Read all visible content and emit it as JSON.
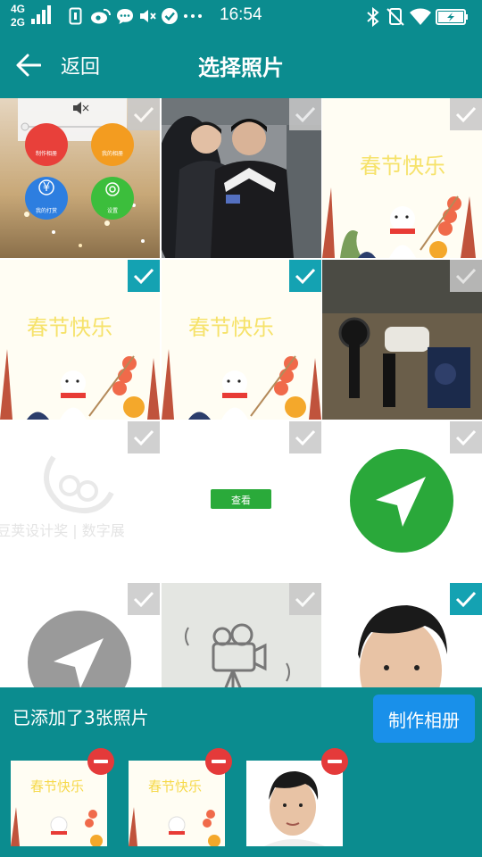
{
  "status_bar": {
    "net_top": "4G",
    "net_bottom": "2G",
    "time": "16:54",
    "icons": [
      "signal-icon",
      "sim-icon",
      "weibo-icon",
      "message-icon",
      "mute-icon",
      "check-icon",
      "more-icon",
      "bluetooth-icon",
      "no-sim-icon",
      "wifi-icon",
      "battery-icon"
    ]
  },
  "header": {
    "back_label": "返回",
    "title": "选择照片"
  },
  "grid": {
    "photos": [
      {
        "name": "screenshot-menu",
        "selected": false,
        "labels": [
          "制作相册",
          "我的相册",
          "我的打赏",
          "设置"
        ]
      },
      {
        "name": "photo-people",
        "selected": false
      },
      {
        "name": "spring-festival-card",
        "selected": false,
        "text": "春节快乐"
      },
      {
        "name": "spring-festival-card",
        "selected": true,
        "text": "春节快乐"
      },
      {
        "name": "spring-festival-card",
        "selected": true,
        "text": "春节快乐"
      },
      {
        "name": "photo-devices",
        "selected": false
      },
      {
        "name": "logo-watermark",
        "selected": false,
        "text": "豆荚设计奖 | 数字展"
      },
      {
        "name": "view-button-image",
        "selected": false,
        "text": "查看"
      },
      {
        "name": "green-send-icon",
        "selected": false
      },
      {
        "name": "grey-send-icon",
        "selected": false
      },
      {
        "name": "camera-sketch",
        "selected": false
      },
      {
        "name": "portrait-man",
        "selected": true
      }
    ]
  },
  "bottom": {
    "added_text": "已添加了3张照片",
    "make_album_label": "制作相册",
    "thumbs": [
      {
        "name": "spring-festival-card",
        "text": "春节快乐"
      },
      {
        "name": "spring-festival-card",
        "text": "春节快乐"
      },
      {
        "name": "portrait-man"
      }
    ]
  },
  "colors": {
    "primary": "#0b8c8f",
    "selected_check": "#14a2b2",
    "button_blue": "#1990ea",
    "remove_red": "#e43a3a"
  }
}
